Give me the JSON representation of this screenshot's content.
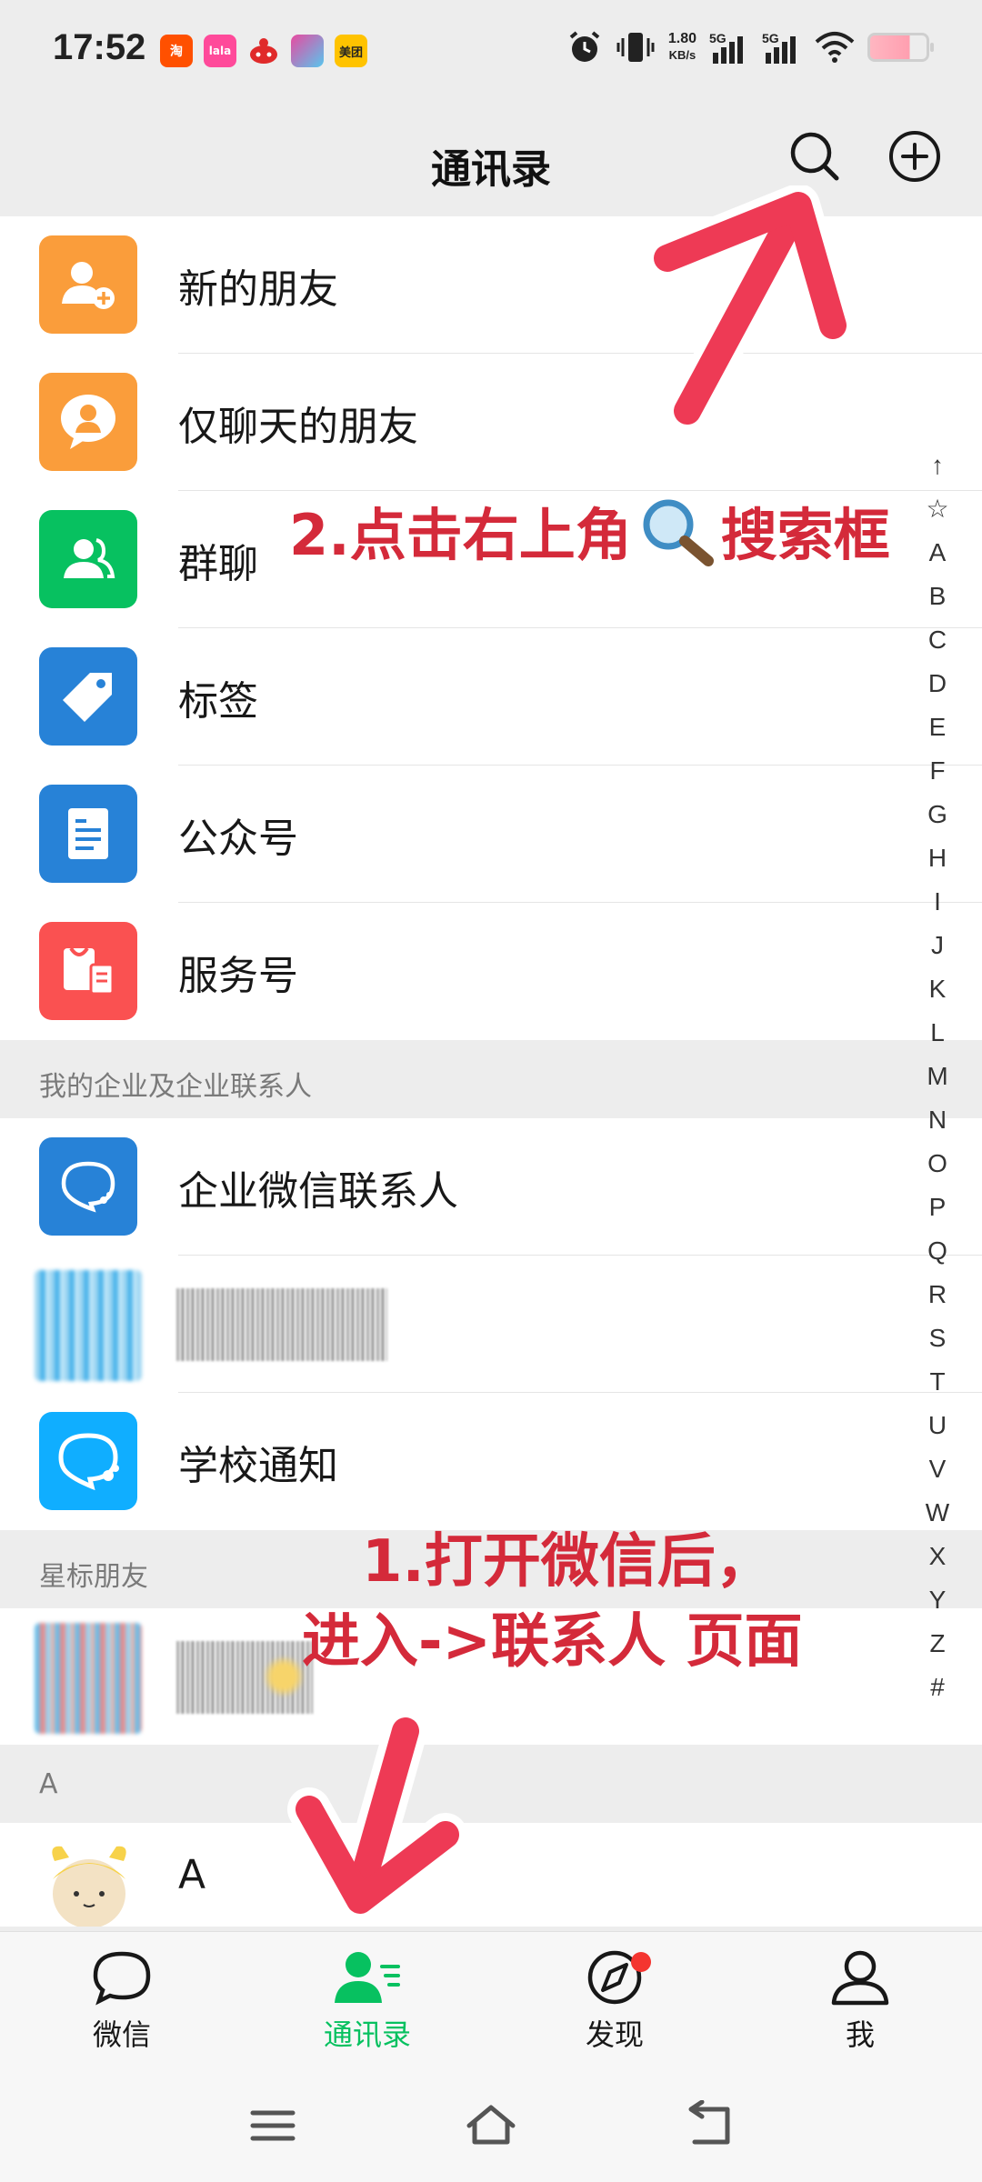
{
  "status_bar": {
    "time": "17:52",
    "notif_icons": [
      {
        "name": "taobao-app-icon",
        "text": "淘",
        "color": "#ff5000"
      },
      {
        "name": "lala-app-icon",
        "text": "lala",
        "color": "#ff4a9a"
      },
      {
        "name": "red-app-icon",
        "text": "",
        "color": "#e02a2a"
      },
      {
        "name": "game-app-icon",
        "text": "",
        "color": "#e94aa0"
      },
      {
        "name": "meituan-app-icon",
        "text": "美团",
        "color": "#ffc300"
      }
    ],
    "net_speed_value": "1.80",
    "net_speed_unit": "KB/s",
    "sim1_label": "5G",
    "sim2_label": "5G"
  },
  "header": {
    "title": "通讯录",
    "search_icon": "search-icon",
    "add_icon": "plus-circle-icon"
  },
  "menu_items": [
    {
      "label": "新的朋友",
      "icon": "add-friend-icon",
      "color": "#fa9d3b"
    },
    {
      "label": "仅聊天的朋友",
      "icon": "chat-only-friend-icon",
      "color": "#fa9d3b"
    },
    {
      "label": "群聊",
      "icon": "group-chat-icon",
      "color": "#07c160"
    },
    {
      "label": "标签",
      "icon": "tag-icon",
      "color": "#2782d7"
    },
    {
      "label": "公众号",
      "icon": "official-account-icon",
      "color": "#2782d7"
    },
    {
      "label": "服务号",
      "icon": "service-account-icon",
      "color": "#fa5151"
    }
  ],
  "sections": {
    "enterprise": "我的企业及企业联系人",
    "starred": "星标朋友",
    "a": "A"
  },
  "enterprise_items": [
    {
      "label": "企业微信联系人",
      "icon": "work-wechat-icon",
      "color": "#2782d7"
    },
    {
      "label": "学校通知",
      "icon": "school-notice-icon",
      "color": "#10aeff"
    }
  ],
  "contact_a": {
    "label": "A"
  },
  "alpha_index": [
    "↑",
    "☆",
    "A",
    "B",
    "C",
    "D",
    "E",
    "F",
    "G",
    "H",
    "I",
    "J",
    "K",
    "L",
    "M",
    "N",
    "O",
    "P",
    "Q",
    "R",
    "S",
    "T",
    "U",
    "V",
    "W",
    "X",
    "Y",
    "Z",
    "#"
  ],
  "annotations": {
    "step2_prefix": "2.点击右上角",
    "step2_suffix": "搜索框",
    "step1_line1": "1.打开微信后，",
    "step1_line2": "进入->联系人  页面"
  },
  "tabs": [
    {
      "label": "微信",
      "icon": "chat-bubble-icon"
    },
    {
      "label": "通讯录",
      "icon": "contacts-icon",
      "active": true
    },
    {
      "label": "发现",
      "icon": "compass-icon",
      "badge": true
    },
    {
      "label": "我",
      "icon": "person-icon"
    }
  ],
  "colors": {
    "wechat_green": "#07c160",
    "annotation_red": "#d42a3a",
    "background": "#ededed"
  }
}
